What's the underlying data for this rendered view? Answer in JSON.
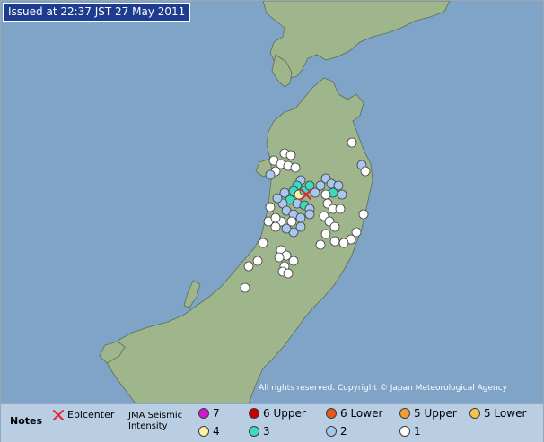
{
  "header": {
    "issued": "Issued at 22:37 JST  27 May 2011"
  },
  "map": {
    "copyright": "All rights reserved. Copyright © Japan Meteorological Agency",
    "colors": {
      "sea": "#7fa4c8",
      "land": "#9fb58b",
      "coast": "#5d6e55"
    }
  },
  "legend": {
    "notes_label": "Notes",
    "epicenter_label": "Epicenter",
    "intensity_label_line1": "JMA Seismic",
    "intensity_label_line2": "Intensity",
    "scale": [
      {
        "label": "7",
        "color": "#d01ad0"
      },
      {
        "label": "6 Upper",
        "color": "#c40000"
      },
      {
        "label": "6 Lower",
        "color": "#e8591b"
      },
      {
        "label": "5 Upper",
        "color": "#f0a030"
      },
      {
        "label": "5 Lower",
        "color": "#f2c64a"
      },
      {
        "label": "4",
        "color": "#fbf3a6"
      },
      {
        "label": "3",
        "color": "#3dd9c0"
      },
      {
        "label": "2",
        "color": "#a8c7ef"
      },
      {
        "label": "1",
        "color": "#ffffff"
      }
    ],
    "epicenter_color": "#e0283a"
  }
}
